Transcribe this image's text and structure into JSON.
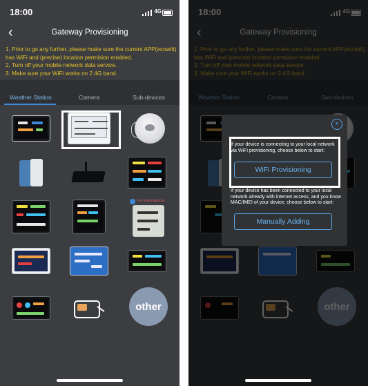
{
  "status": {
    "time": "18:00",
    "network": "4G"
  },
  "nav": {
    "back_glyph": "‹",
    "title": "Gateway Provisioning"
  },
  "notice": [
    "1. Prior to go any further, please make sure the current APP(ecowitt)",
    "has WiFi and (precise) location permision enabled.",
    "2. Turn off your mobile network data service.",
    "3. Make sure your WiFi works on 2.4G band."
  ],
  "tabs": [
    {
      "label": "Weather Station",
      "active": true
    },
    {
      "label": "Camera",
      "active": false
    },
    {
      "label": "Sub-devices",
      "active": false
    }
  ],
  "device_grid": {
    "ble_badge_text": "For International",
    "other_label": "other"
  },
  "dialog": {
    "wifi_text": "If your device is connecting to your local network via WiFi provisioning, choose below to start:",
    "wifi_button": "WiFi Provisioning",
    "manual_text": "If your device has been connected to your local network already with internet access, and you know MAC/IMEI of your device, choose below to start:",
    "manual_button": "Manually Adding",
    "close_glyph": "×"
  },
  "colors": {
    "accent": "#3d8bd6",
    "notice": "#e8c32a",
    "background": "#3b3d40"
  }
}
